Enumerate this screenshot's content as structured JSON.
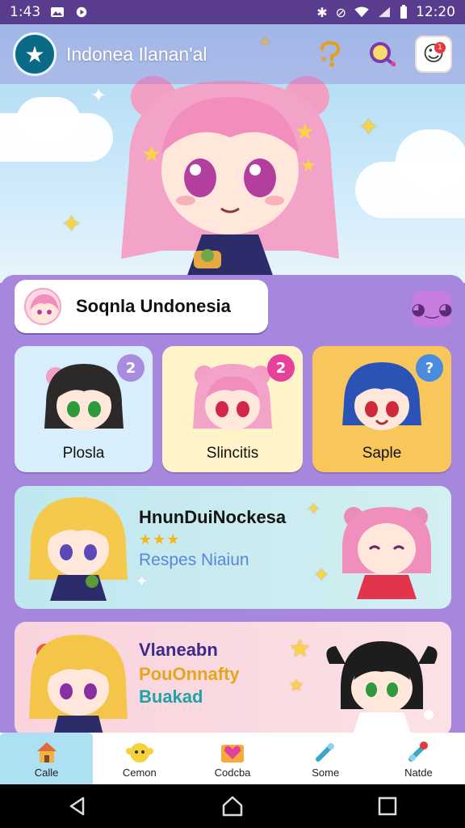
{
  "status_bar": {
    "time_left": "1:43",
    "time_right": "12:20",
    "icons_left": [
      "image-icon",
      "record-icon"
    ],
    "icons_right": [
      "bluetooth-icon",
      "mute-icon",
      "wifi-icon",
      "signal-icon",
      "battery-icon"
    ]
  },
  "app_bar": {
    "title": "Indonea Ilanan'al",
    "logo_icon": "star-icon",
    "actions": [
      "hint-icon",
      "search-icon",
      "profile-icon"
    ],
    "notification_count": "1"
  },
  "name_card": {
    "name": "Soqnla Undonesia",
    "action_icon": "smile-face-icon"
  },
  "tiles": [
    {
      "label": "Plosla",
      "badge": "2",
      "bg": "#d9eefc",
      "badge_color": "#a98bdf"
    },
    {
      "label": "Slincitis",
      "badge": "2",
      "bg": "#fff3c9",
      "badge_color": "#e6419b"
    },
    {
      "label": "Saple",
      "badge": "?",
      "bg": "#f8c65a",
      "badge_color": "#4a8be0"
    }
  ],
  "banner_1": {
    "title": "HnunDuiNockesa",
    "stars": "★★★",
    "subtitle": "Respes Niaiun"
  },
  "banner_2": {
    "line_1": "Vlaneabn",
    "line_2": "PouOnnafty",
    "line_3": "Buakad"
  },
  "bottom_nav": [
    {
      "label": "Calle",
      "icon": "home-icon",
      "active": true
    },
    {
      "label": "Cemon",
      "icon": "mascot-icon",
      "active": false
    },
    {
      "label": "Codcba",
      "icon": "heart-icon",
      "active": false
    },
    {
      "label": "Some",
      "icon": "bottle-icon",
      "active": false
    },
    {
      "label": "Natde",
      "icon": "pacifier-icon",
      "active": false
    }
  ],
  "colors": {
    "panel": "#a787dd",
    "status_bar": "#5a3c8e",
    "active_nav": "#aee0f4"
  }
}
